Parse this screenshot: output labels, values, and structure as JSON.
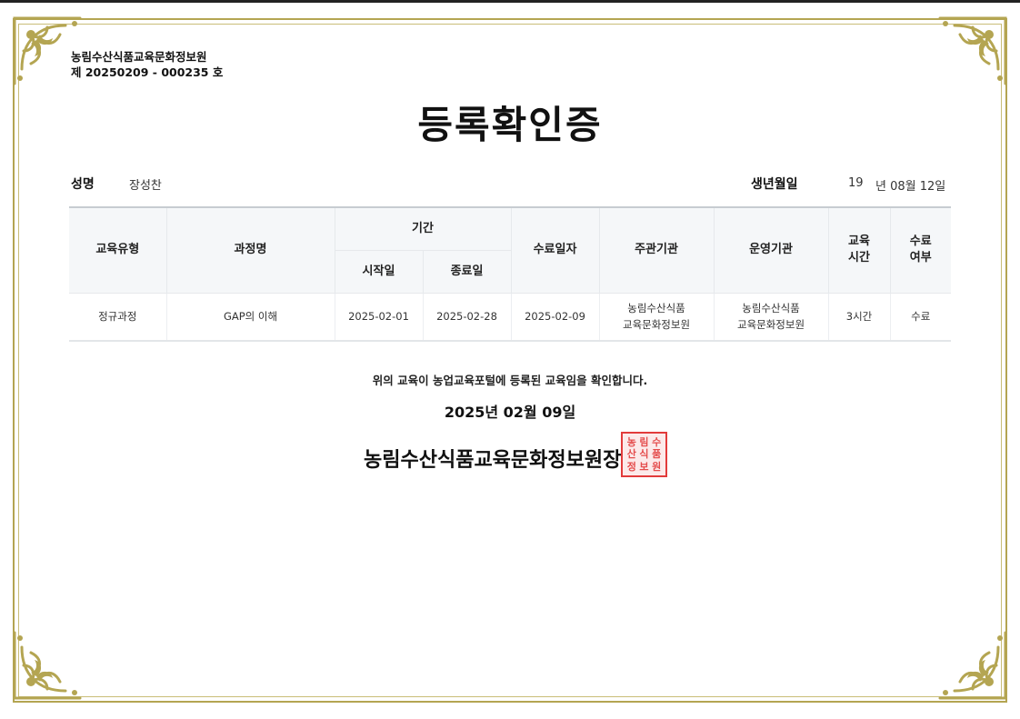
{
  "issuer": {
    "org": "농림수산식품교육문화정보원",
    "serial": "제 20250209 - 000235 호"
  },
  "title": "등록확인증",
  "person": {
    "name_label": "성명",
    "name": "장성찬",
    "birth_label": "생년월일",
    "birth_year": "19",
    "birth_rest": "년 08월 12일"
  },
  "table": {
    "headers": {
      "type": "교육유형",
      "course": "과정명",
      "period": "기간",
      "start": "시작일",
      "end": "종료일",
      "completion_date": "수료일자",
      "host": "주관기관",
      "operator": "운영기관",
      "hours_line1": "교육",
      "hours_line2": "시간",
      "status_line1": "수료",
      "status_line2": "여부"
    },
    "rows": [
      {
        "type": "정규과정",
        "course": "GAP의 이해",
        "start": "2025-02-01",
        "end": "2025-02-28",
        "completion_date": "2025-02-09",
        "host_line1": "농림수산식품",
        "host_line2": "교육문화정보원",
        "operator_line1": "농림수산식품",
        "operator_line2": "교육문화정보원",
        "hours": "3시간",
        "status": "수료"
      }
    ]
  },
  "confirm_text": "위의 교육이 농업교육포털에 등록된 교육임을 확인합니다.",
  "issue_date": "2025년 02월 09일",
  "signer": "농림수산식품교육문화정보원장",
  "seal": {
    "chars": [
      "농",
      "림",
      "수",
      "산",
      "식",
      "품",
      "정",
      "보",
      "원"
    ]
  },
  "colors": {
    "frame_gold": "#b4a552",
    "seal_red": "#e23b3b",
    "table_header_bg": "#f5f7f9"
  }
}
